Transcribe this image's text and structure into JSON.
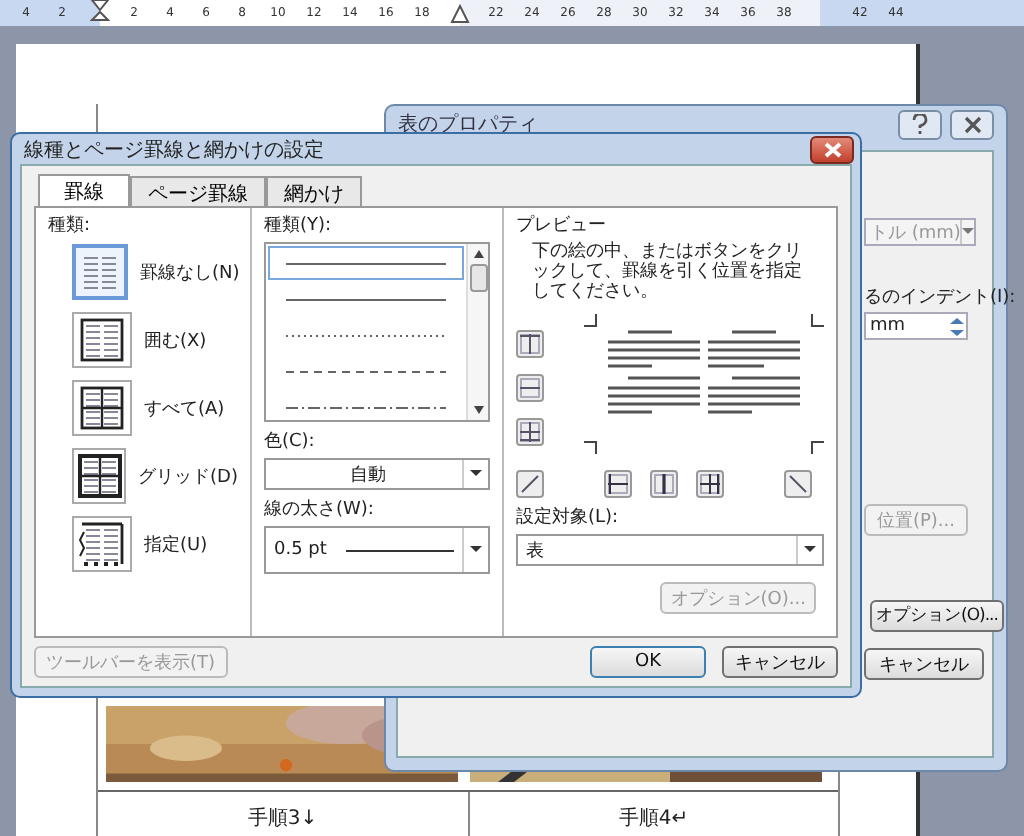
{
  "ruler": {
    "numbers": [
      "4",
      "2",
      "2",
      "4",
      "6",
      "8",
      "10",
      "12",
      "14",
      "16",
      "18",
      "22",
      "24",
      "26",
      "28",
      "30",
      "32",
      "34",
      "36",
      "38",
      "42",
      "44"
    ]
  },
  "document": {
    "captions": [
      "手順3↓",
      "手順4↵"
    ]
  },
  "back_dialog": {
    "title": "表のプロパティ",
    "unit_field": {
      "value": "トル (mm)",
      "disabled": true
    },
    "indent_label": "るのインデント(I):",
    "indent_field": {
      "value": "mm"
    },
    "position_button": {
      "label": "位置(P)...",
      "disabled": true
    },
    "options_button": {
      "label": "オプション(O)...",
      "disabled": false
    },
    "cancel_button": "キャンセル"
  },
  "dialog": {
    "title": "線種とページ罫線と網かけの設定",
    "tabs": [
      {
        "label": "罫線",
        "selected": true
      },
      {
        "label": "ページ罫線",
        "selected": false
      },
      {
        "label": "網かけ",
        "selected": false
      }
    ],
    "setting": {
      "label": "種類:",
      "options": [
        {
          "label": "罫線なし(N)",
          "kind": "none",
          "selected": true
        },
        {
          "label": "囲む(X)",
          "kind": "box",
          "selected": false
        },
        {
          "label": "すべて(A)",
          "kind": "all",
          "selected": false
        },
        {
          "label": "グリッド(D)",
          "kind": "grid",
          "selected": false
        },
        {
          "label": "指定(U)",
          "kind": "custom",
          "selected": false
        }
      ]
    },
    "style": {
      "label": "種類(Y):",
      "lines": [
        {
          "kind": "solid",
          "selected": true
        },
        {
          "kind": "solid",
          "selected": false
        },
        {
          "kind": "dotted",
          "selected": false
        },
        {
          "kind": "dashed",
          "selected": false
        },
        {
          "kind": "dash-dot",
          "selected": false
        }
      ]
    },
    "color": {
      "label": "色(C):",
      "value": "自動"
    },
    "width": {
      "label": "線の太さ(W):",
      "value": "0.5 pt"
    },
    "preview": {
      "label": "プレビュー",
      "hint": "下の絵の中、またはボタンをクリックして、罫線を引く位置を指定してください。"
    },
    "apply_to": {
      "label": "設定対象(L):",
      "value": "表"
    },
    "options_button": {
      "label": "オプション(O)...",
      "disabled": true
    },
    "toolbar_button": {
      "label": "ツールバーを表示(T)",
      "disabled": true
    },
    "ok_button": "OK",
    "cancel_button": "キャンセル"
  }
}
